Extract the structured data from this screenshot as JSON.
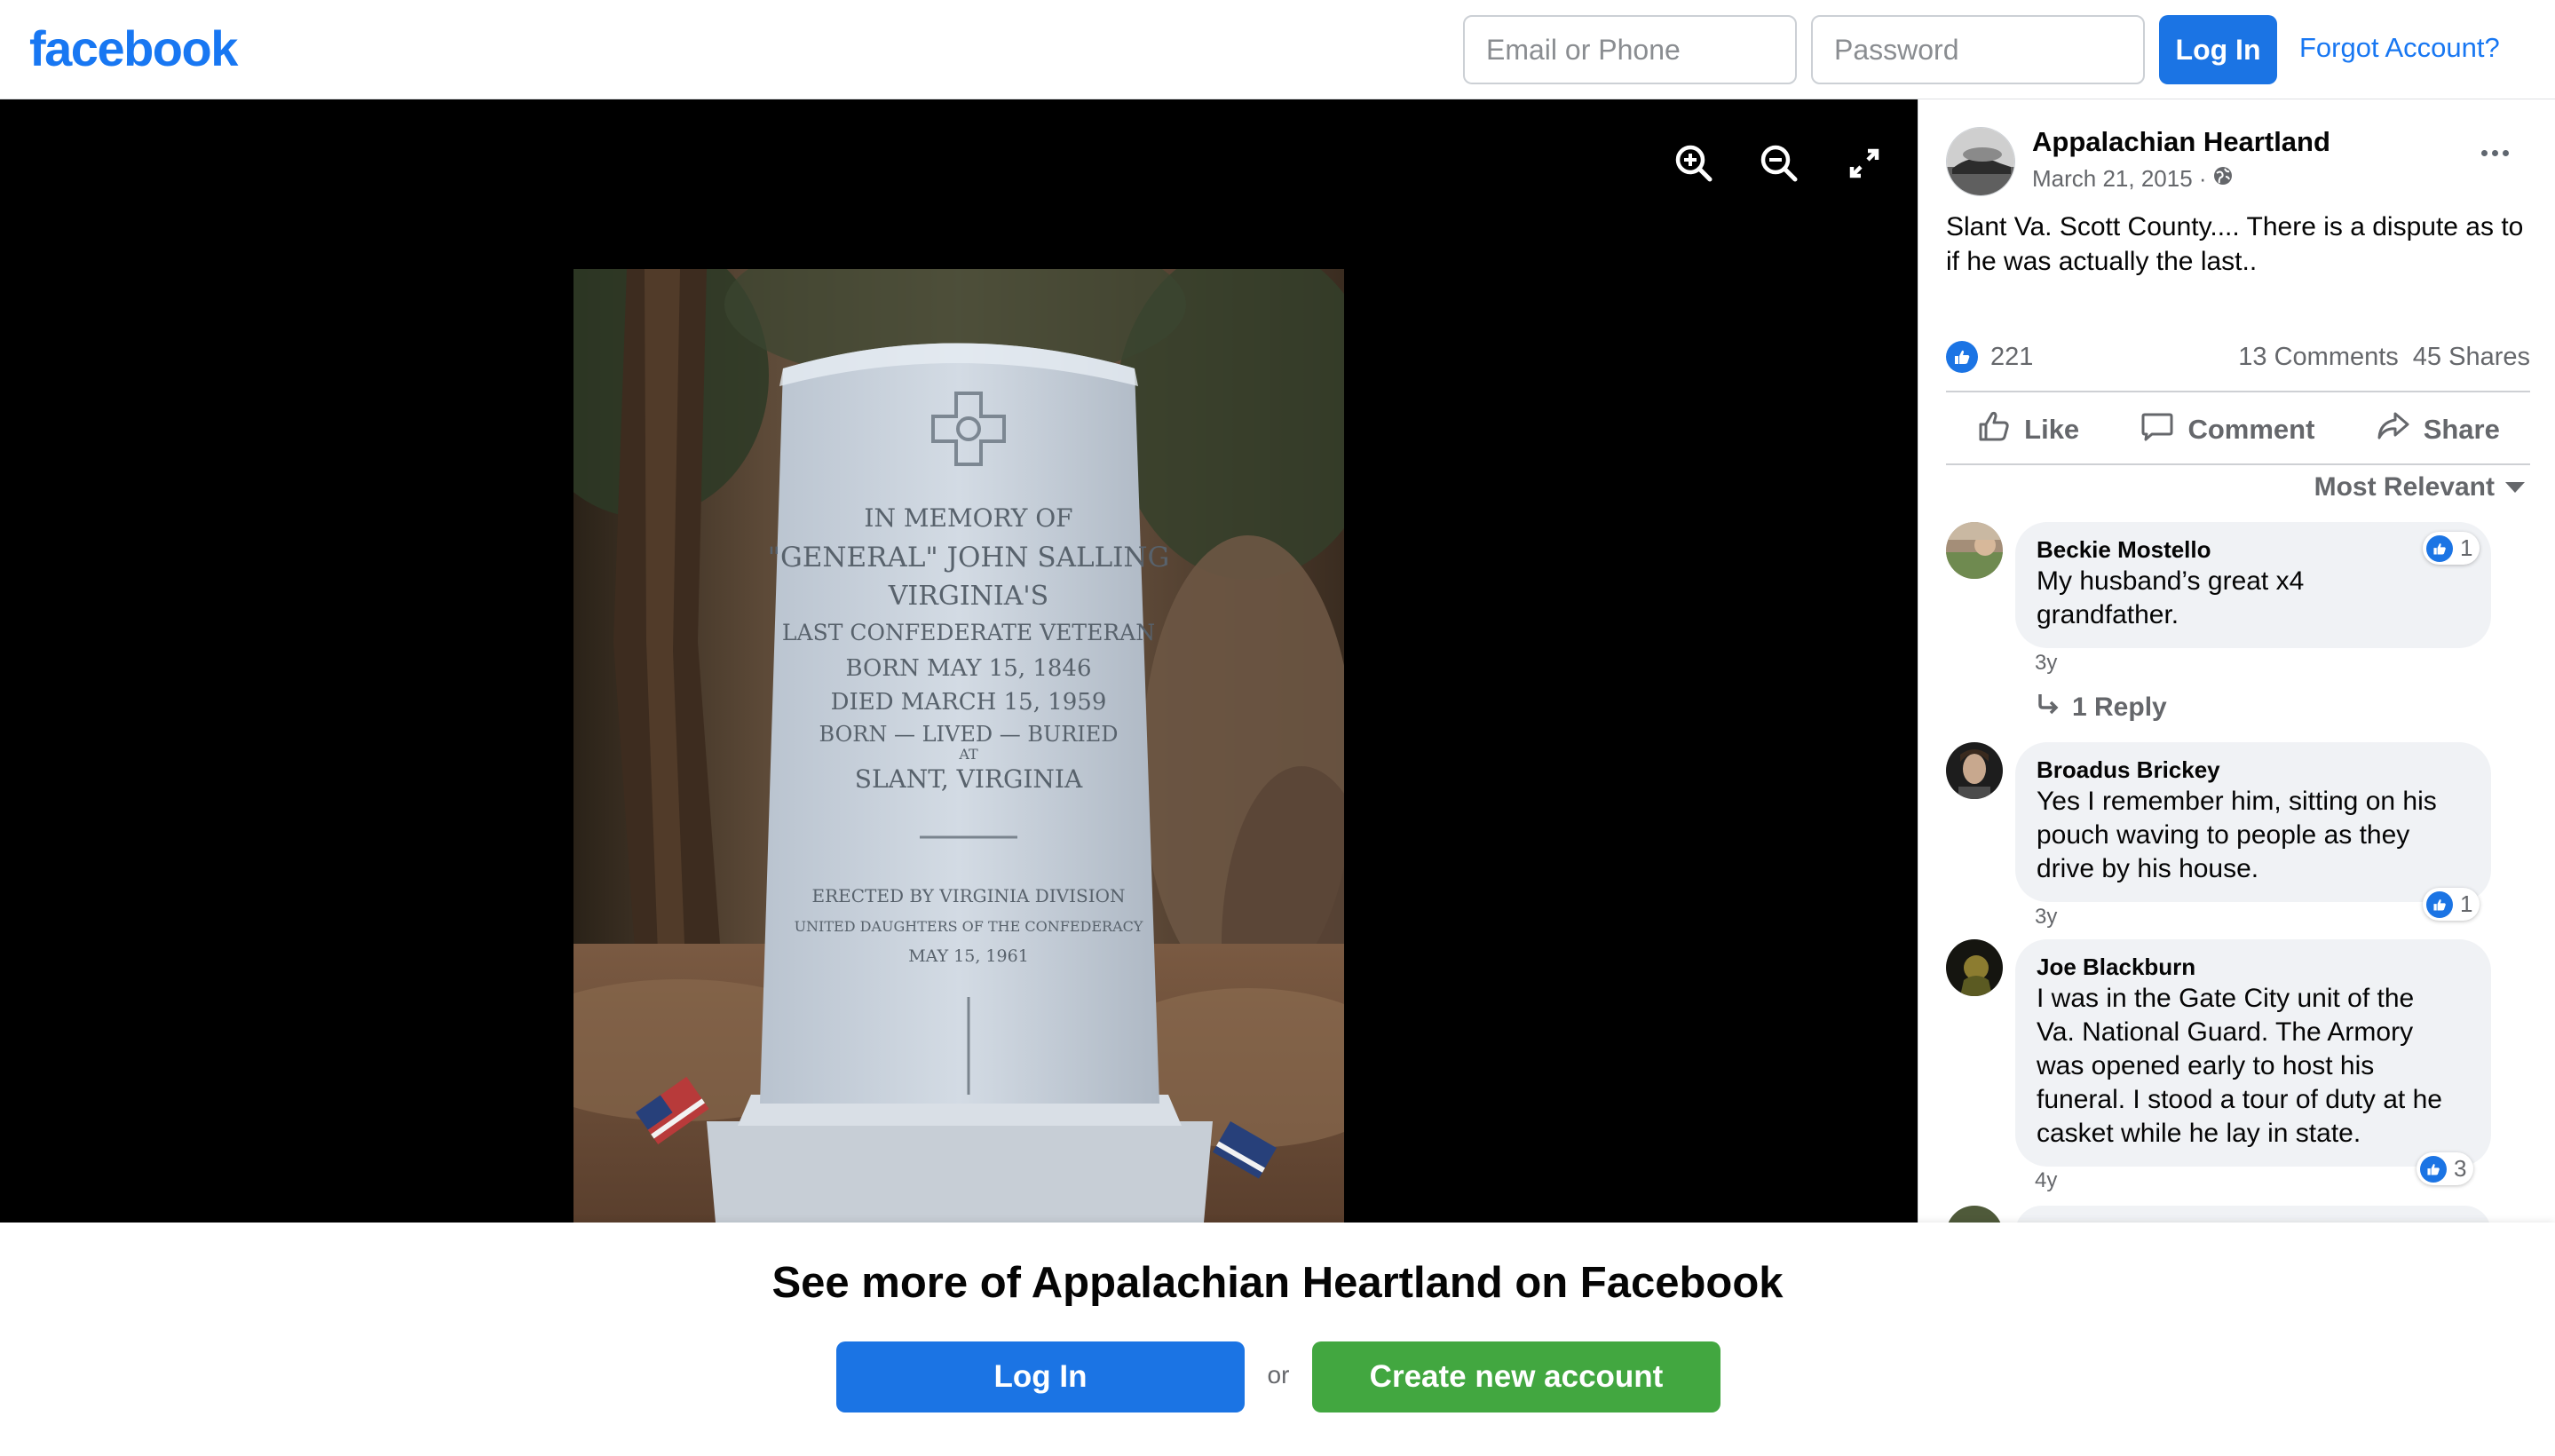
{
  "header": {
    "logo": "facebook",
    "email_placeholder": "Email or Phone",
    "password_placeholder": "Password",
    "login_label": "Log In",
    "forgot_label": "Forgot Account?"
  },
  "viewer": {
    "tools": [
      "zoom-in-icon",
      "zoom-out-icon",
      "fullscreen-icon"
    ],
    "photo": {
      "description_icon": "memorial-stone-photo",
      "inscription": [
        "IN MEMORY OF",
        "\"GENERAL\" JOHN SALLING",
        "VIRGINIA'S",
        "LAST CONFEDERATE VETERAN",
        "BORN MAY 15, 1846",
        "DIED MARCH 15, 1959",
        "BORN — LIVED — BURIED",
        "AT",
        "SLANT, VIRGINIA",
        "ERECTED BY VIRGINIA DIVISION",
        "UNITED DAUGHTERS OF THE CONFEDERACY",
        "MAY 15, 1961"
      ]
    }
  },
  "post": {
    "page_name": "Appalachian Heartland",
    "date": "March 21, 2015 ·",
    "audience_icon": "globe-icon",
    "text": "Slant Va. Scott County.... There is a dispute as to if he was actually the last..",
    "reactions": "221",
    "comments": "13 Comments",
    "shares": "45 Shares",
    "actions": {
      "like": "Like",
      "comment": "Comment",
      "share": "Share"
    },
    "sort_label": "Most Relevant"
  },
  "comments": [
    {
      "name": "Beckie Mostello",
      "lines": [
        "My husband’s great x4",
        "grandfather."
      ],
      "likes": "1",
      "age": "3y",
      "replies": "1 Reply"
    },
    {
      "name": "Broadus Brickey",
      "lines": [
        "Yes I remember him, sitting on his",
        "pouch waving to people as they",
        "drive by his house."
      ],
      "likes": "1",
      "age": "3y"
    },
    {
      "name": "Joe Blackburn",
      "lines": [
        "I was in the Gate City unit of the",
        "Va. National Guard. The Armory",
        "was opened early to host his",
        "funeral. I stood a tour of duty at he",
        "casket while he lay in state."
      ],
      "likes": "3",
      "age": "4y"
    }
  ],
  "banner": {
    "title": "See more of Appalachian Heartland on Facebook",
    "login_label": "Log In",
    "or_label": "or",
    "create_label": "Create new account"
  },
  "colors": {
    "brand": "#1877f2",
    "button_blue": "#1b74e4",
    "button_green": "#42a740",
    "viewer_bg": "#000000"
  }
}
